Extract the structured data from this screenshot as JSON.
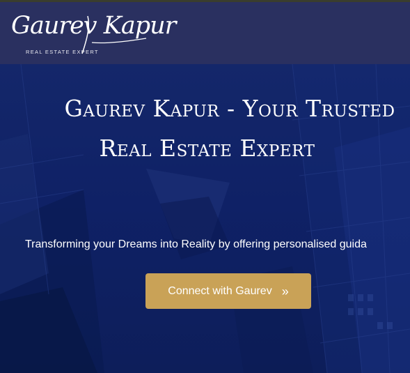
{
  "header": {
    "logo_script": "Gaurev Kapur",
    "logo_subtitle": "REAL ESTATE EXPERT"
  },
  "hero": {
    "title_line1": "Gaurev Kapur - Your Trusted",
    "title_line2": "Real Estate Expert",
    "subtitle": "Transforming your Dreams into Reality by offering personalised guida",
    "cta_label": "Connect with Gaurev",
    "cta_icon": "double-chevron-right-icon"
  },
  "colors": {
    "header_bg": "#2a3060",
    "hero_bg": "#0f2166",
    "cta_bg": "#c9a257",
    "text": "#ffffff"
  }
}
